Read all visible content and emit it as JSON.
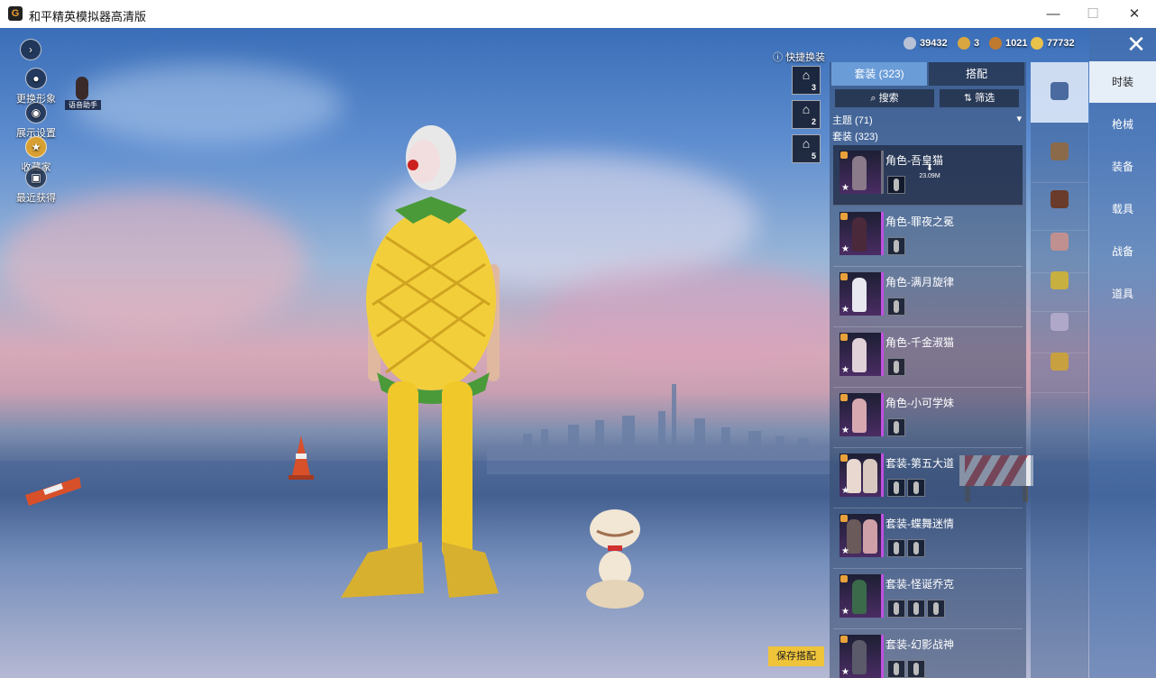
{
  "window": {
    "title": "和平精英模拟器高清版",
    "app_icon": "G",
    "minimize_glyph": "—",
    "maximize_glyph": "☐",
    "close_glyph": "✕"
  },
  "left_sidebar": {
    "expand_glyph": "›",
    "items": [
      {
        "label": "更换形象",
        "icon": "person-icon"
      },
      {
        "label": "展示设置",
        "icon": "eye-icon"
      },
      {
        "label": "收藏家",
        "icon": "medal-icon"
      },
      {
        "label": "最近获得",
        "icon": "gift-icon"
      }
    ],
    "assistant_label": "语音助手"
  },
  "currency": [
    {
      "icon": "silver-coin-icon",
      "value": "39432",
      "color": "#b9c2d4"
    },
    {
      "icon": "rank-badge-icon",
      "value": "3",
      "color": "#d9a640"
    },
    {
      "icon": "bronze-coin-icon",
      "value": "1021",
      "color": "#c07a30"
    },
    {
      "icon": "gold-coin-icon",
      "value": "77732",
      "color": "#e8c24a"
    }
  ],
  "quick_change": {
    "label": "快捷换装",
    "slots": [
      "3",
      "2",
      "5"
    ]
  },
  "outfit_panel": {
    "tabs": [
      {
        "label": "套装 (323)",
        "active": true
      },
      {
        "label": "搭配",
        "active": false
      }
    ],
    "search_label": "搜索",
    "filter_label": "筛选",
    "section_theme": "主题 (71)",
    "section_suits": "套装 (323)",
    "download_size": "23.09M",
    "items": [
      {
        "name": "角色-吾皇猫",
        "sub_count": 1,
        "selected": true,
        "downloading": true
      },
      {
        "name": "角色-罪夜之冕",
        "sub_count": 1,
        "selected": false
      },
      {
        "name": "角色-满月旋律",
        "sub_count": 1,
        "selected": false
      },
      {
        "name": "角色-千金淑猫",
        "sub_count": 1,
        "selected": false
      },
      {
        "name": "角色-小可学妹",
        "sub_count": 1,
        "selected": false
      },
      {
        "name": "套装-第五大道",
        "sub_count": 2,
        "selected": false
      },
      {
        "name": "套装-蝶舞迷情",
        "sub_count": 2,
        "selected": false
      },
      {
        "name": "套装-怪诞乔克",
        "sub_count": 3,
        "selected": false
      },
      {
        "name": "套装-幻影战神",
        "sub_count": 2,
        "selected": false
      }
    ]
  },
  "category_icons": [
    {
      "icon": "hanger-icon",
      "active": true,
      "color": "#4a6aa0"
    },
    {
      "icon": "hat-icon",
      "active": false,
      "color": "#8a6a4a"
    },
    {
      "icon": "mask-icon",
      "active": false,
      "color": "#6a3a2a"
    },
    {
      "icon": "face-icon",
      "active": false,
      "color": "#c09090"
    },
    {
      "icon": "jacket-icon",
      "active": false,
      "color": "#c8b040"
    },
    {
      "icon": "pants-icon",
      "active": false,
      "color": "#b0a8c8"
    },
    {
      "icon": "shoes-icon",
      "active": false,
      "color": "#c8a040"
    }
  ],
  "right_nav": {
    "close_glyph": "✕",
    "items": [
      {
        "label": "时装",
        "active": true
      },
      {
        "label": "枪械",
        "active": false
      },
      {
        "label": "装备",
        "active": false
      },
      {
        "label": "载具",
        "active": false
      },
      {
        "label": "战备",
        "active": false
      },
      {
        "label": "道具",
        "active": false
      }
    ]
  },
  "save_button": "保存搭配",
  "colors": {
    "accent_tab": "#6a9cd8",
    "save_button": "#f0c43a",
    "rarity_purple": "#c050e0",
    "outfit_yellow": "#f2cf3a"
  }
}
